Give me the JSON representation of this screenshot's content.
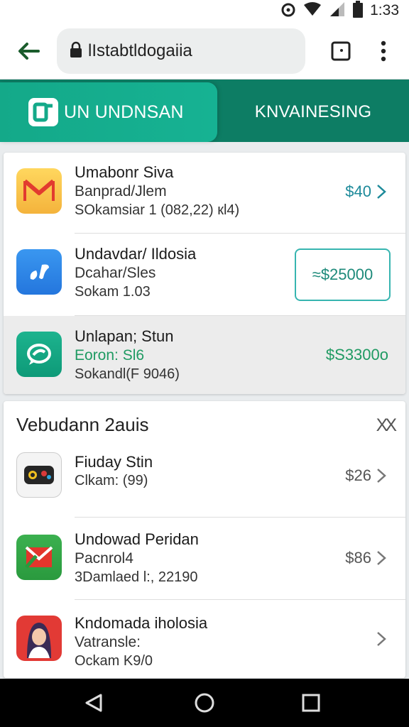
{
  "status_bar": {
    "time": "1:33"
  },
  "toolbar": {
    "url": "lIstabtldogaiia"
  },
  "tabs": [
    {
      "label": "UN UNDNSAN",
      "active": true
    },
    {
      "label": "KNVAINESING",
      "active": false
    }
  ],
  "colors": {
    "accent": "#14a989",
    "accent_dark": "#0d7d64",
    "price_teal": "#1d8a9a",
    "price_green": "#1f9a62"
  },
  "list": [
    {
      "title": "Umabonr Siva",
      "line2": "Banprad/Jlem",
      "line3": "SOkamsiar 1 (082,22) кl4)",
      "price": "$40",
      "icon": "gmail-icon"
    },
    {
      "title": "Undavdar/ Ildosia",
      "line2": "Dcahar/Sles",
      "line3": "Sokam 1.03",
      "price": "≈$25000",
      "icon": "music-icon"
    },
    {
      "title": "Unlapan; Stun",
      "line2": "Eoron: Sl6",
      "line3": "Sokandl(F 9046)",
      "price": "$S3300o",
      "icon": "chat-icon"
    }
  ],
  "section": {
    "title": "Vebudann 2auis",
    "close_label": "XX",
    "items": [
      {
        "title": "Fiuday Stin",
        "line2": "",
        "line3": "Clkam: (99)",
        "price": "$26",
        "icon": "camera-app-icon"
      },
      {
        "title": "Undowad Peridan",
        "line2": "Pacnrol4",
        "line3": "3Damlaed l:, 22190",
        "price": "$86",
        "icon": "mail-app-icon"
      },
      {
        "title": "Kndomada iholosia",
        "line2": "Vatransle:",
        "line3": "Ockam K9/0",
        "price": "",
        "icon": "avatar-app-icon"
      }
    ]
  }
}
